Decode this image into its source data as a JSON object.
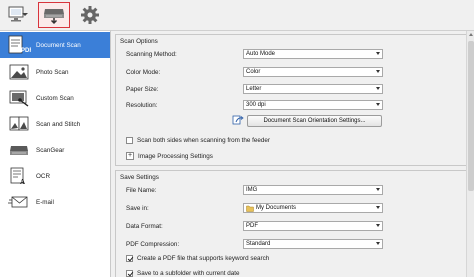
{
  "toolbar": {
    "buttons": [
      {
        "icon": "computer-scan-icon"
      },
      {
        "icon": "scanner-from-computer-icon"
      },
      {
        "icon": "gear-icon"
      }
    ],
    "accent": "#d8343c"
  },
  "sidebar": {
    "active_color": "#3b7fd8",
    "items": [
      {
        "label": "Document Scan",
        "icon": "document-scan-icon"
      },
      {
        "label": "Photo Scan",
        "icon": "photo-scan-icon"
      },
      {
        "label": "Custom Scan",
        "icon": "custom-scan-icon"
      },
      {
        "label": "Scan and Stitch",
        "icon": "scan-and-stitch-icon"
      },
      {
        "label": "ScanGear",
        "icon": "scangear-icon"
      },
      {
        "label": "OCR",
        "icon": "ocr-icon"
      },
      {
        "label": "E-mail",
        "icon": "email-icon"
      }
    ]
  },
  "scan_options": {
    "title": "Scan Options",
    "scanning_method": {
      "label": "Scanning Method:",
      "value": "Auto Mode"
    },
    "color_mode": {
      "label": "Color Mode:",
      "value": "Color"
    },
    "paper_size": {
      "label": "Paper Size:",
      "value": "Letter"
    },
    "resolution": {
      "label": "Resolution:",
      "value": "300 dpi"
    },
    "orientation_button": "Document Scan Orientation Settings...",
    "scan_both_sides": {
      "label": "Scan both sides when scanning from the feeder",
      "checked": false
    },
    "image_processing": "Image Processing Settings"
  },
  "save_settings": {
    "title": "Save Settings",
    "file_name": {
      "label": "File Name:",
      "value": "IMG"
    },
    "save_in": {
      "label": "Save in:",
      "value": "My Documents"
    },
    "data_format": {
      "label": "Data Format:",
      "value": "PDF"
    },
    "pdf_compression": {
      "label": "PDF Compression:",
      "value": "Standard"
    },
    "keyword_search": {
      "label": "Create a PDF file that supports keyword search",
      "checked": true
    },
    "subfolder": {
      "label": "Save to a subfolder with current date",
      "checked": true
    }
  }
}
